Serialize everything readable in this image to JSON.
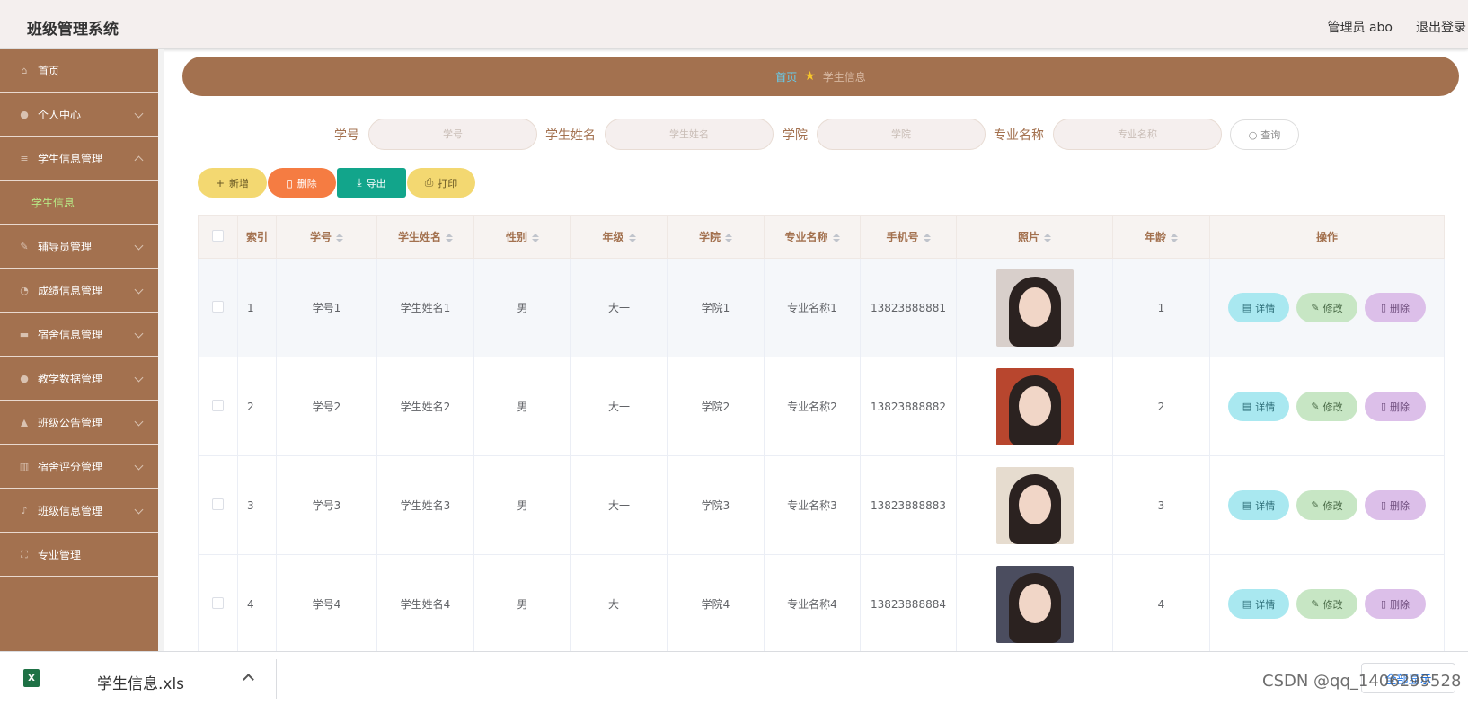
{
  "header": {
    "title": "班级管理系统",
    "admin": "管理员 abo",
    "logout": "退出登录"
  },
  "sidebar": {
    "items": [
      {
        "label": "首页",
        "icon": "home-icon"
      },
      {
        "label": "个人中心",
        "icon": "user-icon"
      },
      {
        "label": "学生信息管理",
        "icon": "list-icon"
      },
      {
        "label": "辅导员管理",
        "icon": "edit-icon"
      },
      {
        "label": "成绩信息管理",
        "icon": "chart-icon"
      },
      {
        "label": "宿舍信息管理",
        "icon": "card-icon"
      },
      {
        "label": "教学数据管理",
        "icon": "user-icon"
      },
      {
        "label": "班级公告管理",
        "icon": "bell-icon"
      },
      {
        "label": "宿舍评分管理",
        "icon": "building-icon"
      },
      {
        "label": "班级信息管理",
        "icon": "mic-icon"
      },
      {
        "label": "专业管理",
        "icon": "fullscreen-icon"
      }
    ],
    "sub_item": "学生信息"
  },
  "breadcrumb": {
    "home": "首页",
    "current": "学生信息"
  },
  "search": {
    "fields": [
      {
        "label": "学号",
        "placeholder": "学号"
      },
      {
        "label": "学生姓名",
        "placeholder": "学生姓名"
      },
      {
        "label": "学院",
        "placeholder": "学院"
      },
      {
        "label": "专业名称",
        "placeholder": "专业名称"
      }
    ],
    "button": "查询"
  },
  "actions": {
    "add": "新增",
    "delete": "删除",
    "export": "导出",
    "print": "打印"
  },
  "table": {
    "headers": [
      "索引",
      "学号",
      "学生姓名",
      "性别",
      "年级",
      "学院",
      "专业名称",
      "手机号",
      "照片",
      "年龄",
      "操作"
    ],
    "rows": [
      {
        "index": "1",
        "id": "学号1",
        "name": "学生姓名1",
        "gender": "男",
        "grade": "大一",
        "college": "学院1",
        "major": "专业名称1",
        "phone": "13823888881",
        "age": "1"
      },
      {
        "index": "2",
        "id": "学号2",
        "name": "学生姓名2",
        "gender": "男",
        "grade": "大一",
        "college": "学院2",
        "major": "专业名称2",
        "phone": "13823888882",
        "age": "2"
      },
      {
        "index": "3",
        "id": "学号3",
        "name": "学生姓名3",
        "gender": "男",
        "grade": "大一",
        "college": "学院3",
        "major": "专业名称3",
        "phone": "13823888883",
        "age": "3"
      },
      {
        "index": "4",
        "id": "学号4",
        "name": "学生姓名4",
        "gender": "男",
        "grade": "大一",
        "college": "学院4",
        "major": "专业名称4",
        "phone": "13823888884",
        "age": "4"
      }
    ],
    "row_actions": {
      "detail": "详情",
      "edit": "修改",
      "delete": "删除"
    }
  },
  "download": {
    "filename": "学生信息.xls",
    "show_all": "全部显示",
    "file_icon": "X"
  },
  "watermark": "CSDN @qq_1406299528",
  "colors": {
    "sidebar": "#a3714f",
    "accent_label": "#a3714f",
    "add_btn": "#f3d871",
    "delete_btn": "#f57c42",
    "export_btn": "#12a58b",
    "print_btn": "#f3d871",
    "detail_btn": "#a9e8f0",
    "edit_btn": "#c7e6c4",
    "del_row_btn": "#dcbfe9"
  }
}
